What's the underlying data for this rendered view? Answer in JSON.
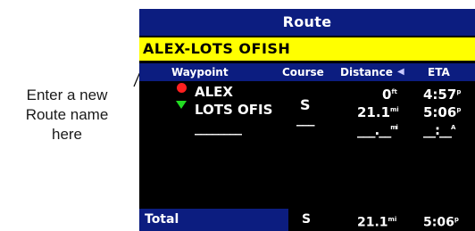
{
  "annotation": {
    "line1": "Enter a new",
    "line2": "Route name",
    "line3": "here"
  },
  "screen": {
    "title": "Route",
    "route_name": "ALEX-LOTS OFISH",
    "columns": {
      "waypoint": "Waypoint",
      "course": "Course",
      "distance": "Distance",
      "sort_arrow": "◀",
      "eta": "ETA"
    },
    "rows": [
      {
        "icon": "red-circle-icon",
        "name": "ALEX",
        "distance": "0",
        "distance_unit": "ft",
        "eta": "4:57",
        "eta_suffix": "p"
      },
      {
        "icon": "green-triangle-icon",
        "name": "LOTS OFIS",
        "distance": "21.1",
        "distance_unit": "mi",
        "eta": "5:06",
        "eta_suffix": "p"
      }
    ],
    "course_value": "S",
    "empty_row": {
      "name": "________",
      "course": "___",
      "distance": "___.__",
      "distance_unit": "mi",
      "eta": "__:__",
      "eta_suffix": "A"
    },
    "total": {
      "label": "Total",
      "course": "S",
      "distance": "21.1",
      "distance_unit": "mi",
      "eta": "5:06",
      "eta_suffix": "p"
    },
    "colors": {
      "title_bg": "#0c1d80",
      "name_bg": "#ffff00",
      "screen_bg": "#000000"
    }
  }
}
